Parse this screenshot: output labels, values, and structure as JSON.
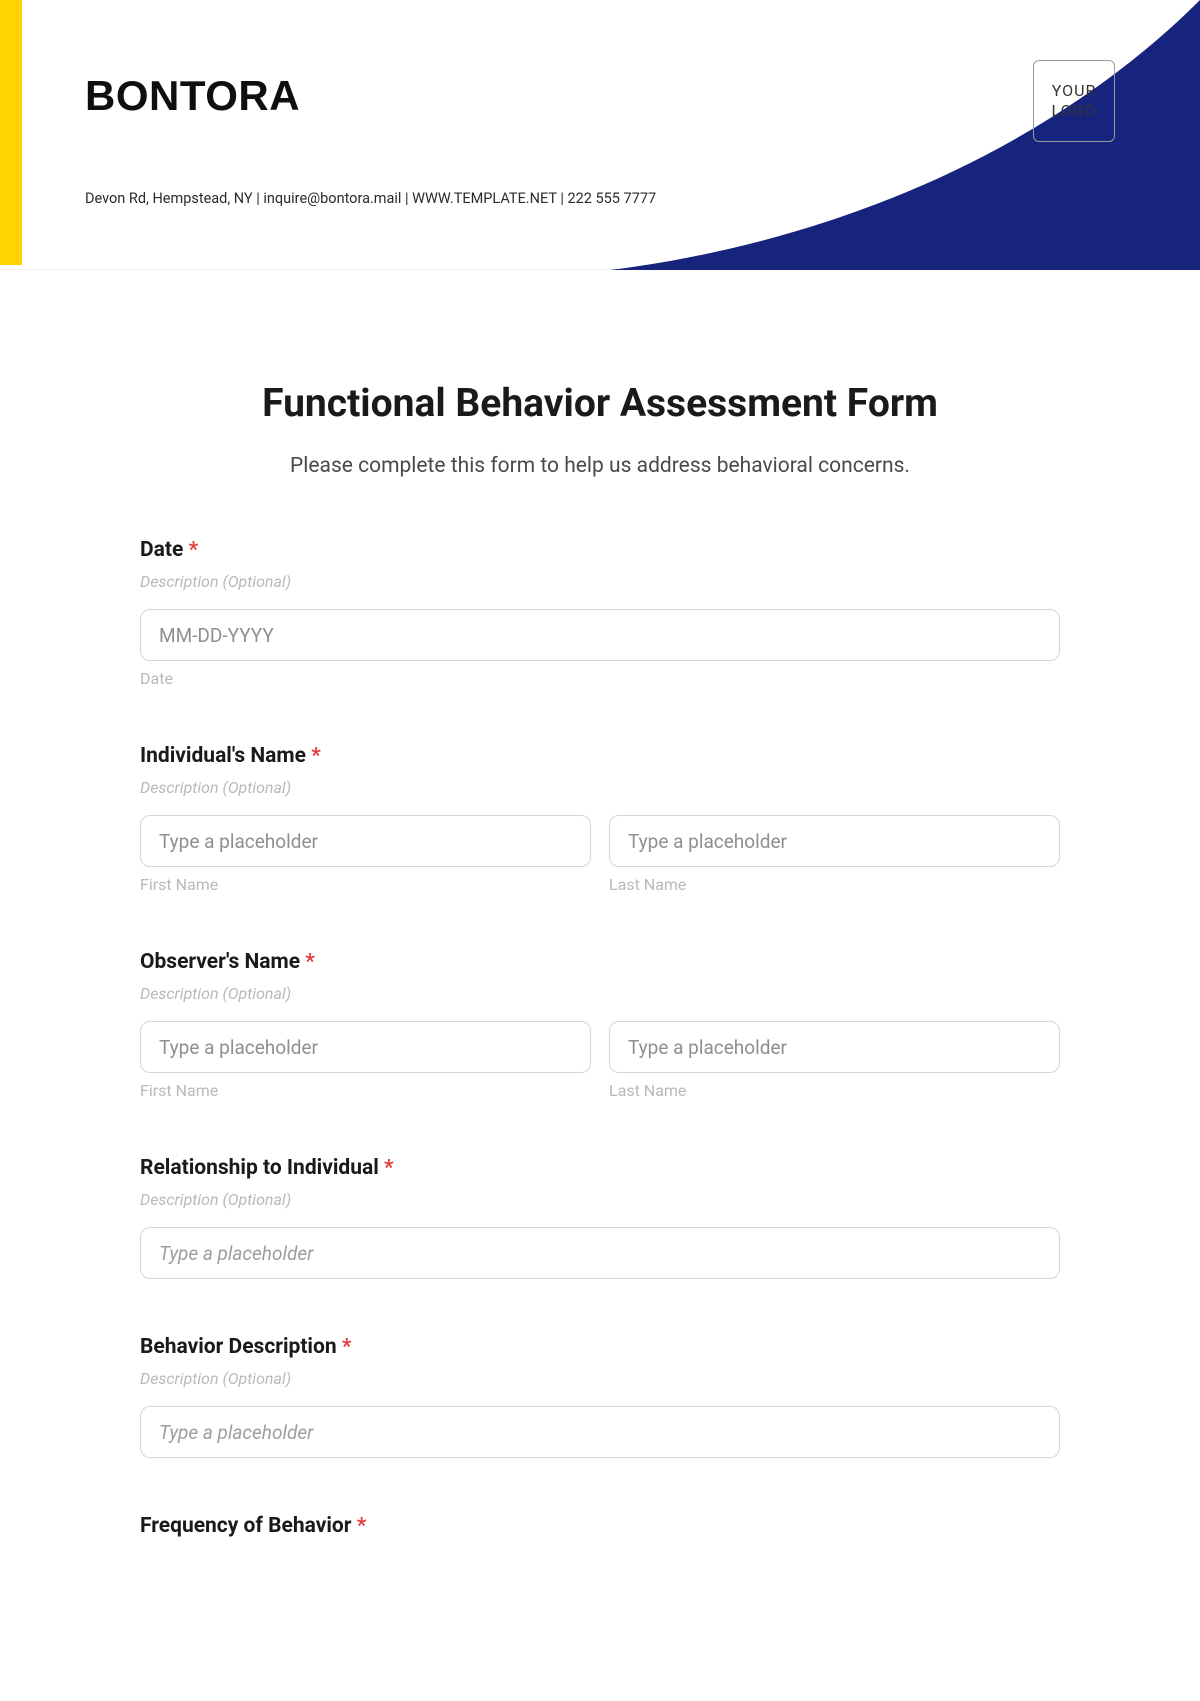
{
  "header": {
    "brand": "BONTORA",
    "contact": "Devon Rd, Hempstead, NY | inquire@bontora.mail | WWW.TEMPLATE.NET | 222 555 7777",
    "logo_text": "YOUR\nLOGO"
  },
  "form": {
    "title": "Functional Behavior Assessment Form",
    "subtitle": "Please complete this form to help us address behavioral concerns.",
    "required_mark": "*",
    "desc_optional": "Description (Optional)",
    "fields": {
      "date": {
        "label": "Date",
        "placeholder": "MM-DD-YYYY",
        "sublabel": "Date"
      },
      "individual": {
        "label": "Individual's Name",
        "first_placeholder": "Type a placeholder",
        "last_placeholder": "Type a placeholder",
        "first_sub": "First Name",
        "last_sub": "Last Name"
      },
      "observer": {
        "label": "Observer's Name",
        "first_placeholder": "Type a placeholder",
        "last_placeholder": "Type a placeholder",
        "first_sub": "First Name",
        "last_sub": "Last Name"
      },
      "relationship": {
        "label": "Relationship to Individual",
        "placeholder": "Type a placeholder"
      },
      "behavior_desc": {
        "label": "Behavior Description",
        "placeholder": "Type a placeholder"
      },
      "frequency": {
        "label": "Frequency of Behavior"
      }
    }
  }
}
